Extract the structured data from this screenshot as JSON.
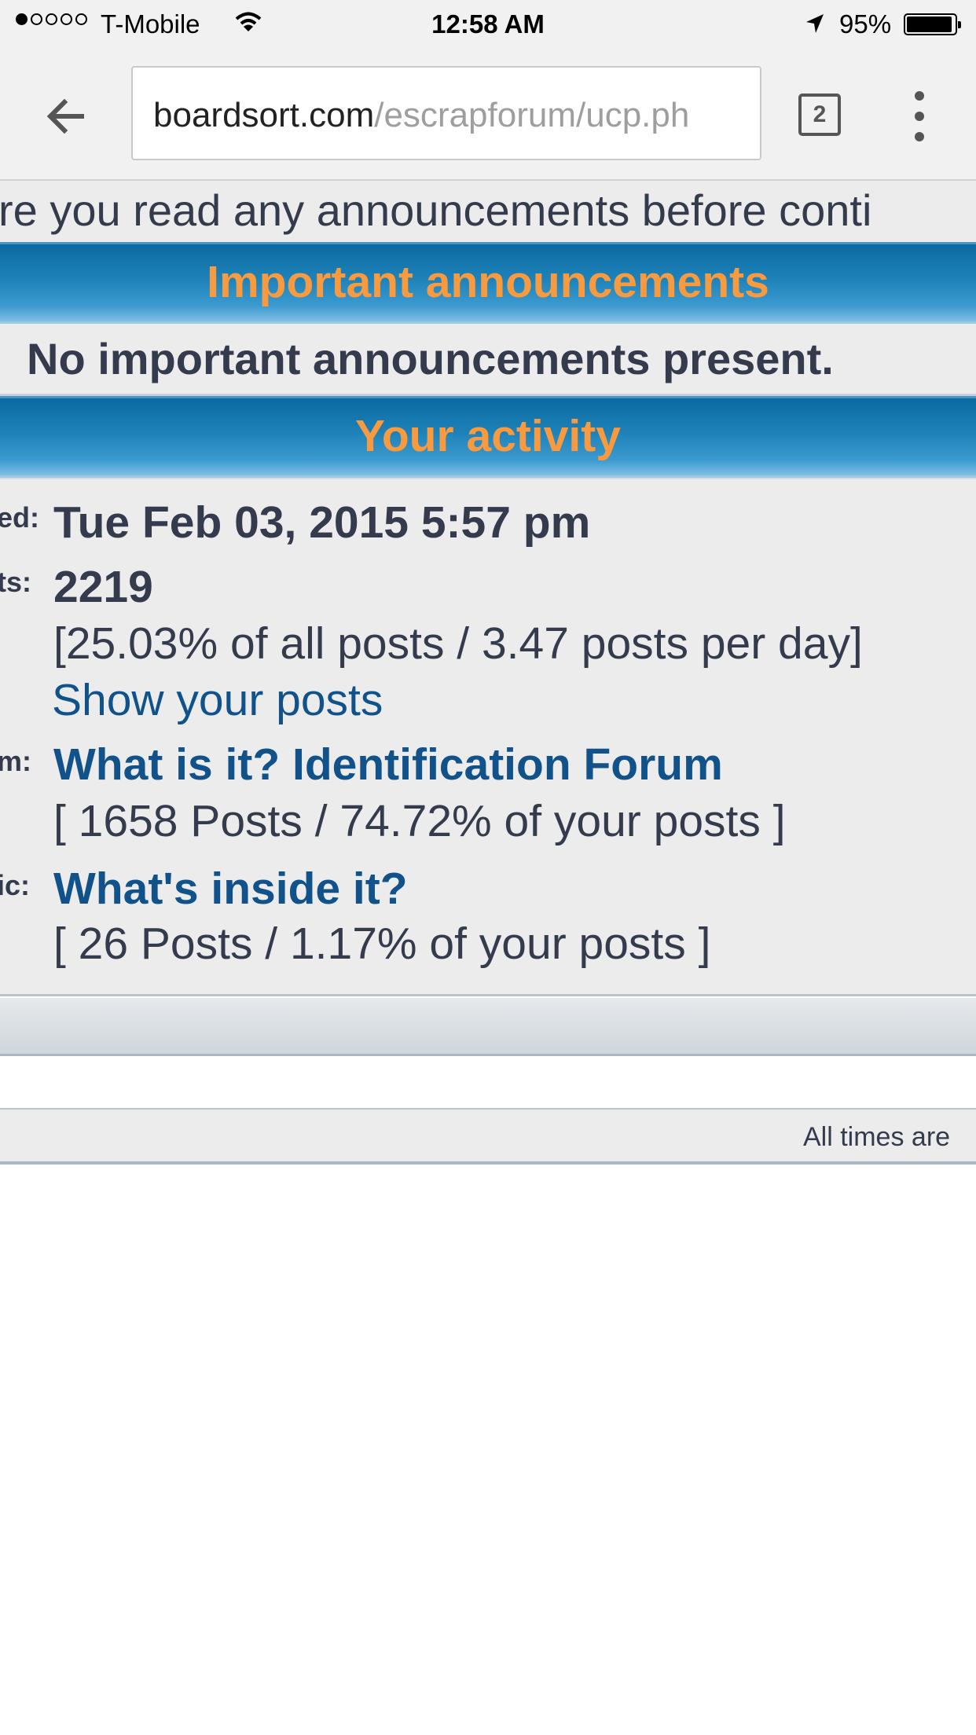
{
  "status_bar": {
    "carrier": "T-Mobile",
    "time": "12:58 AM",
    "battery_percent": "95%",
    "signal_bars": 1,
    "signal_total": 5,
    "battery_level": 0.95
  },
  "browser": {
    "url_domain": "boardsort.com",
    "url_path": "/escrapforum/ucp.ph",
    "tab_count": "2",
    "icons": [
      "back-arrow-icon",
      "tabs-icon",
      "overflow-menu-icon",
      "wifi-icon",
      "location-arrow-icon",
      "battery-icon"
    ]
  },
  "page": {
    "intro_text": "re you read any announcements before conti",
    "announcements": {
      "header": "Important announcements",
      "empty_text": "No important announcements present."
    },
    "activity": {
      "header": "Your activity",
      "joined_label": "ed:",
      "joined_value": "Tue Feb 03, 2015 5:57 pm",
      "posts_label": "ts:",
      "posts_count": "2219",
      "posts_stats": "[25.03% of all posts / 3.47 posts per day]",
      "show_posts_link": "Show your posts",
      "forum_label": "m:",
      "most_active_forum": "What is it? Identification Forum",
      "forum_stats": "[ 1658 Posts / 74.72% of your posts ]",
      "topic_label": "ic:",
      "most_active_topic": "What's inside it?",
      "topic_stats": "[ 26 Posts / 1.17% of your posts ]"
    },
    "footer_text": "All times are"
  },
  "colors": {
    "header_blue": "#1e82b8",
    "header_text_orange": "#f89a40",
    "link_blue": "#105289",
    "body_text": "#333b4d",
    "panel_bg": "#ececec"
  }
}
